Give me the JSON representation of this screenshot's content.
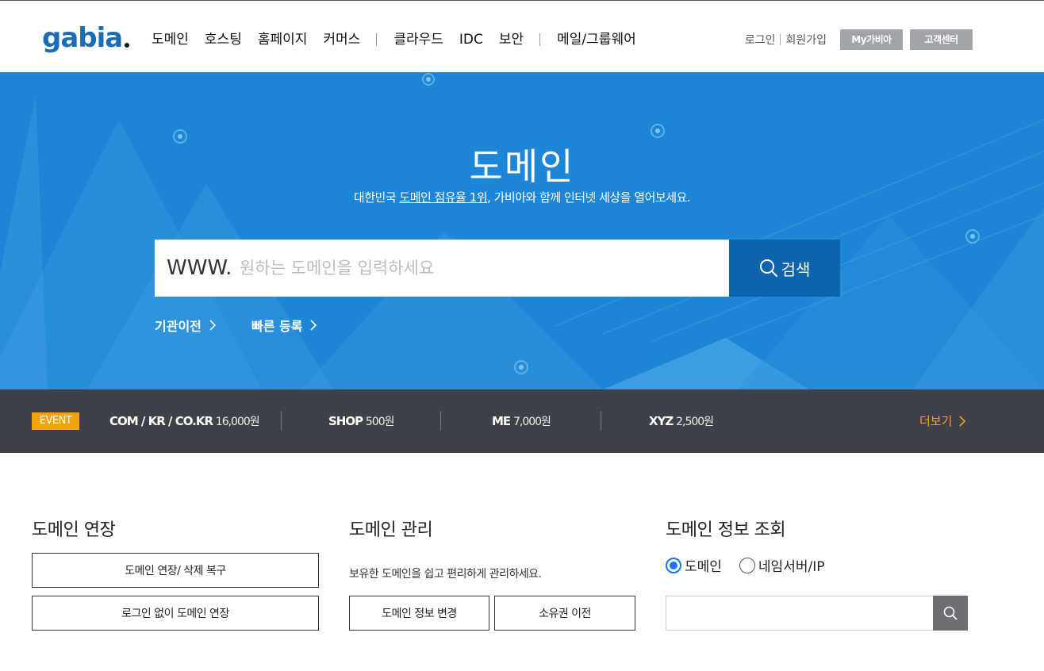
{
  "header": {
    "logo": "gabia",
    "nav": [
      "도메인",
      "호스팅",
      "홈페이지",
      "커머스",
      "클라우드",
      "IDC",
      "보안",
      "메일/그룹웨어"
    ],
    "login": "로그인",
    "signup": "회원가입",
    "mygabia": "My가비아",
    "support": "고객센터"
  },
  "hero": {
    "title": "도메인",
    "subtitle_pre": "대한민국 ",
    "subtitle_link": "도메인 점유율 1위",
    "subtitle_post": ", 가비아와 함께 인터넷 세상을 열어보세요.",
    "prefix": "WWW.",
    "placeholder": "원하는 도메인을 입력하세요",
    "search_label": "검색",
    "transfer": "기관이전",
    "quick_register": "빠른 등록"
  },
  "event": {
    "badge": "EVENT",
    "items": [
      {
        "name": "COM / KR / CO.KR",
        "price": "16,000원"
      },
      {
        "name": "SHOP",
        "price": "500원"
      },
      {
        "name": "ME",
        "price": "7,000원"
      },
      {
        "name": "XYZ",
        "price": "2,500원"
      }
    ],
    "more": "더보기"
  },
  "renew": {
    "title": "도메인 연장",
    "btn1": "도메인 연장/ 삭제 복구",
    "btn2": "로그인 없이 도메인 연장"
  },
  "manage": {
    "title": "도메인 관리",
    "desc": "보유한 도메인을 쉽고 편리하게 관리하세요.",
    "btn1": "도메인 정보 변경",
    "btn2": "소유권 이전"
  },
  "whois": {
    "title": "도메인 정보 조회",
    "opt1": "도메인",
    "opt2": "네임서버/IP",
    "selected": "도메인",
    "value": ""
  },
  "colors": {
    "hero_bg": "#1d86d6",
    "search_btn": "#0b64ad",
    "event_bg": "#3f4148",
    "accent": "#f2a20a"
  }
}
